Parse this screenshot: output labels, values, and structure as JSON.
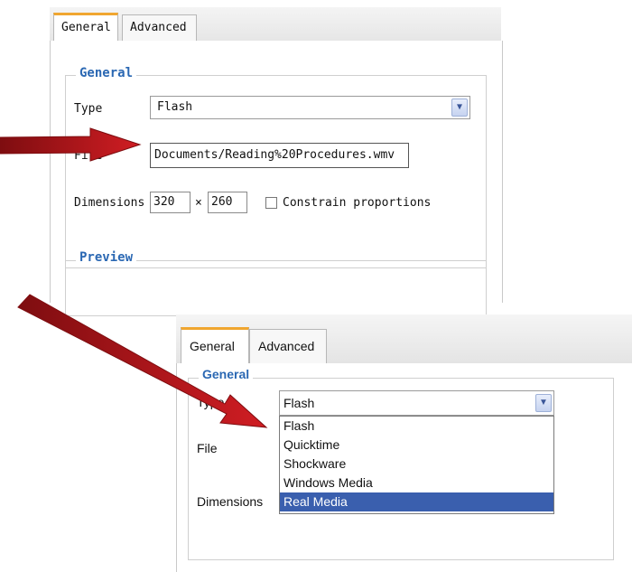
{
  "top": {
    "tabs": [
      "General",
      "Advanced"
    ],
    "legend": "General",
    "type_label": "Type",
    "type_value": "Flash",
    "file_label": "File",
    "file_value": "Documents/Reading%20Procedures.wmv",
    "dimensions_label": "Dimensions",
    "width_value": "320",
    "times_sign": "×",
    "height_value": "260",
    "constrain_label": "Constrain proportions",
    "preview_legend": "Preview"
  },
  "bottom": {
    "tabs": [
      "General",
      "Advanced"
    ],
    "legend": "General",
    "type_label": "Type",
    "type_value": "Flash",
    "file_label": "File",
    "dimensions_label": "Dimensions",
    "options": [
      "Flash",
      "Quicktime",
      "Shockware",
      "Windows Media",
      "Real Media"
    ],
    "selected_option": "Real Media"
  },
  "colors": {
    "tab_accent": "#f0a630",
    "legend_text": "#2b68b3",
    "selection_bg": "#3a5fae",
    "arrow": "#c4161c"
  },
  "icons": [
    "chevron-down-icon",
    "red-arrow-icon"
  ]
}
